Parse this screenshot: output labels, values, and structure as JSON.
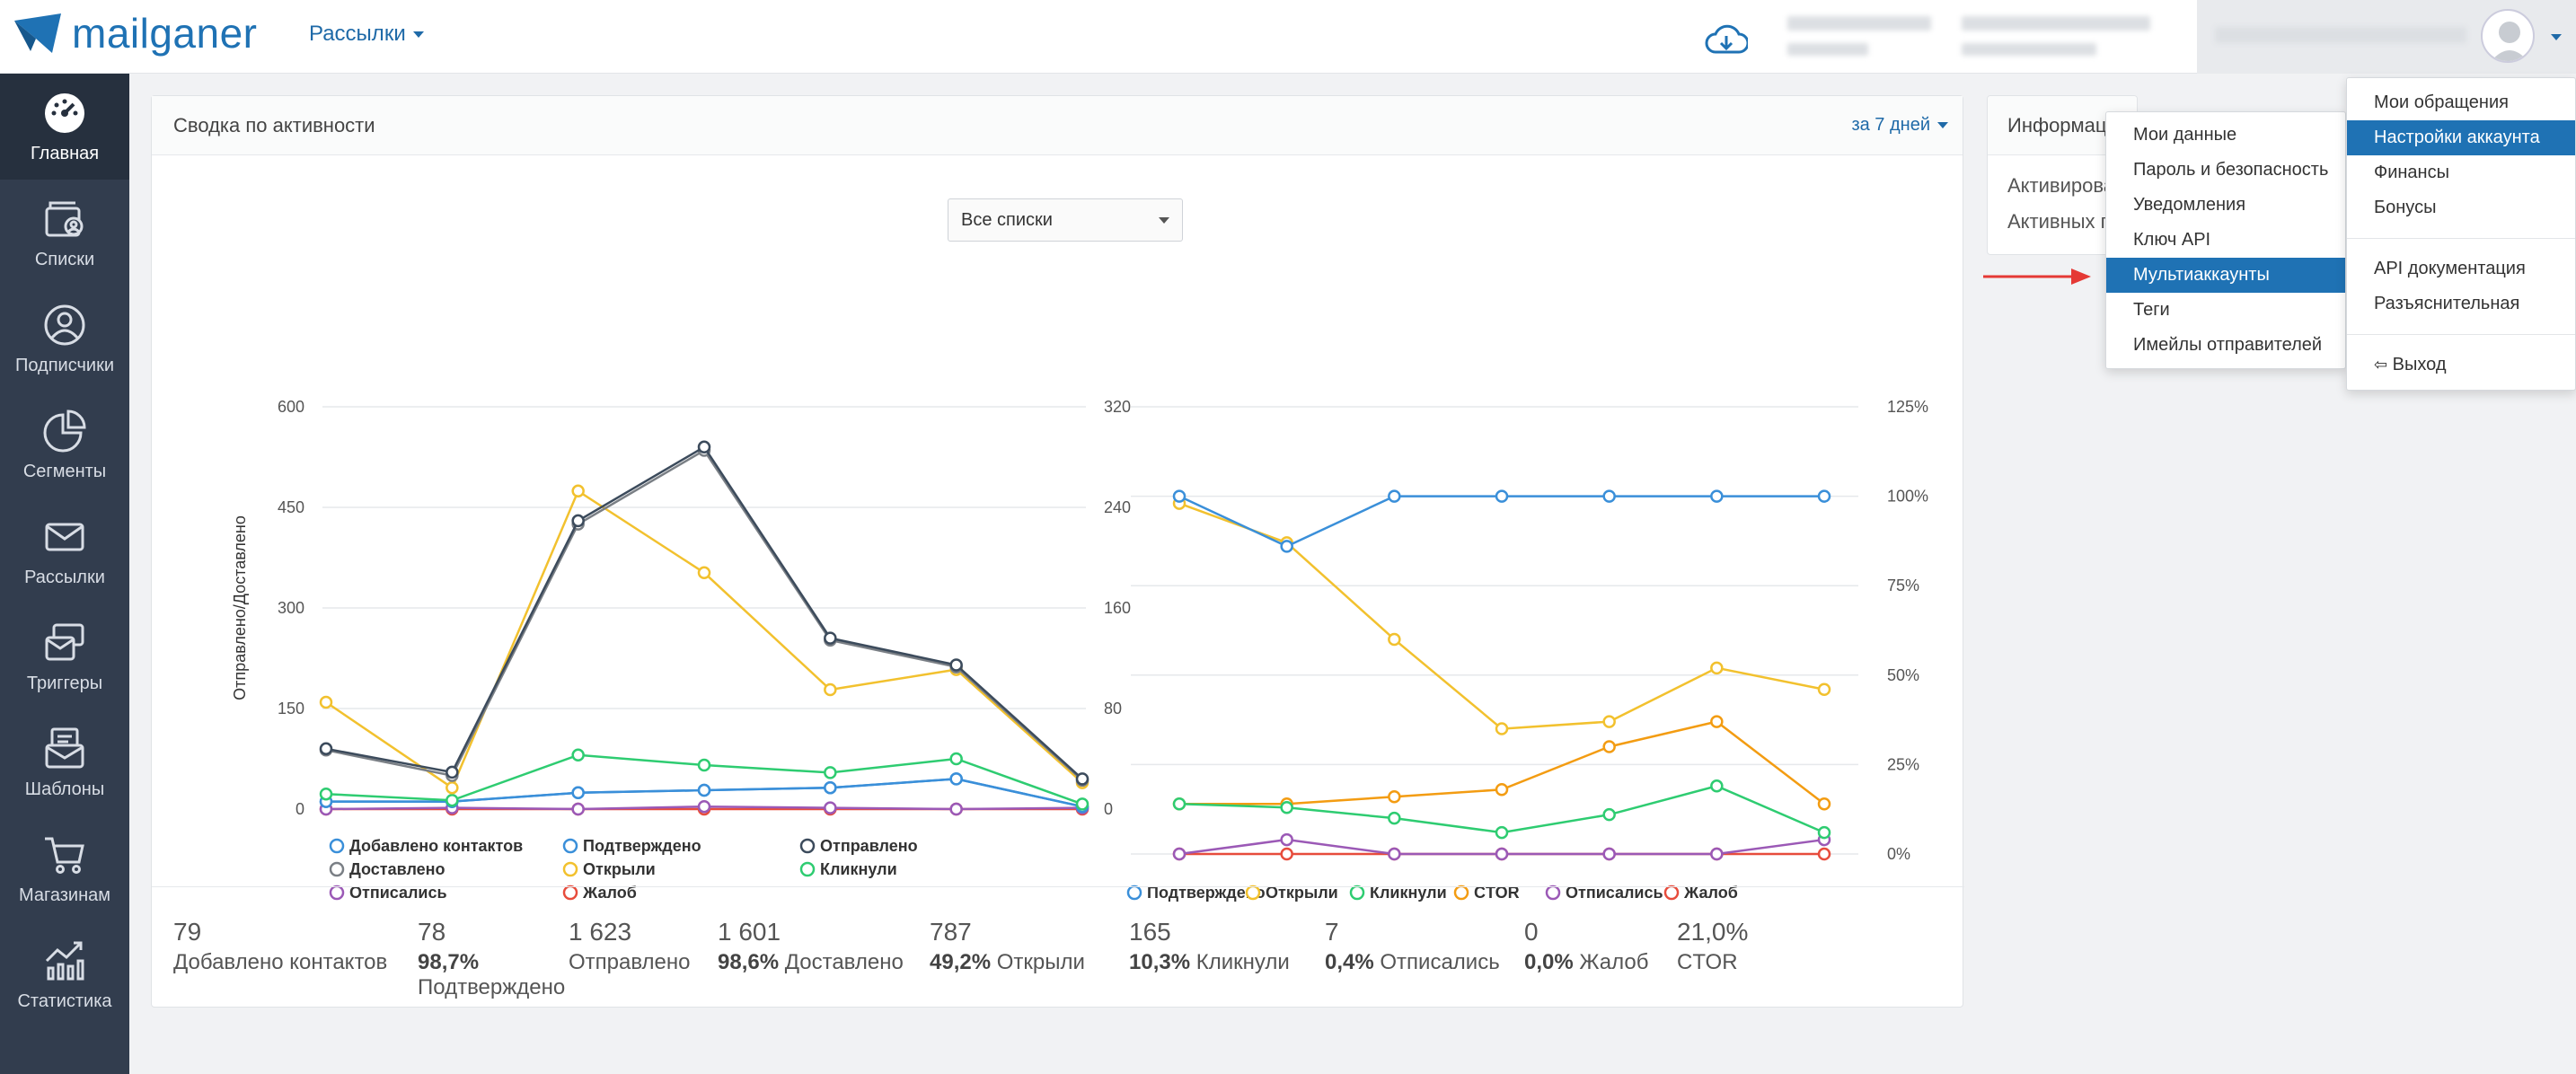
{
  "brand": {
    "name": "mailganer"
  },
  "topnav": {
    "mailings_label": "Рассылки"
  },
  "sidebar": {
    "items": [
      {
        "label": "Главная",
        "icon": "dashboard-icon"
      },
      {
        "label": "Списки",
        "icon": "lists-icon"
      },
      {
        "label": "Подписчики",
        "icon": "user-icon"
      },
      {
        "label": "Сегменты",
        "icon": "pie-icon"
      },
      {
        "label": "Рассылки",
        "icon": "envelope-icon"
      },
      {
        "label": "Триггеры",
        "icon": "trigger-icon"
      },
      {
        "label": "Шаблоны",
        "icon": "template-icon"
      },
      {
        "label": "Магазинам",
        "icon": "cart-icon"
      },
      {
        "label": "Статистика",
        "icon": "stats-icon"
      }
    ]
  },
  "activity": {
    "title": "Сводка по активности",
    "period": "за 7 дней",
    "list_select": "Все списки"
  },
  "info": {
    "title": "Информаци",
    "line1": "Активирова",
    "line2": "Активных п"
  },
  "stats": [
    {
      "num": "79",
      "pct": "",
      "label": "Добавлено контактов"
    },
    {
      "num": "78",
      "pct": "98,7%",
      "label": "Подтверждено"
    },
    {
      "num": "1 623",
      "pct": "",
      "label": "Отправлено"
    },
    {
      "num": "1 601",
      "pct": "98,6%",
      "label": "Доставлено"
    },
    {
      "num": "787",
      "pct": "49,2%",
      "label": "Открыли"
    },
    {
      "num": "165",
      "pct": "10,3%",
      "label": "Кликнули"
    },
    {
      "num": "7",
      "pct": "0,4%",
      "label": "Отписались"
    },
    {
      "num": "0",
      "pct": "0,0%",
      "label": "Жалоб"
    },
    {
      "num": "21,0%",
      "pct": "",
      "label": "CTOR"
    }
  ],
  "account_menu": {
    "items": [
      "Мои обращения",
      "Настройки аккаунта",
      "Финансы",
      "Бонусы",
      "API документация",
      "Разъяснительная",
      "Выход"
    ],
    "highlighted": "Настройки аккаунта"
  },
  "submenu": {
    "items": [
      "Мои данные",
      "Пароль и безопасность",
      "Уведомления",
      "Ключ API",
      "Мультиаккаунты",
      "Теги",
      "Имейлы отправителей"
    ],
    "highlighted": "Мультиаккаунты"
  },
  "colors": {
    "accent": "#1f72b4",
    "sidebar": "#323d4e",
    "blue": "#3a8fd9",
    "dark": "#3c4b5c",
    "gray": "#7a7f85",
    "yellow": "#f2c12e",
    "green": "#2ecc71",
    "orange": "#f39c12",
    "purple": "#9b59b6",
    "red": "#e74c3c"
  },
  "chart_data": [
    {
      "type": "line",
      "x_points": 7,
      "ylabel": "Отправлено/Доставлено",
      "ylim_left": [
        0,
        600
      ],
      "yticks_left": [
        "0",
        "150",
        "300",
        "450",
        "600"
      ],
      "ylim_right": [
        0,
        320
      ],
      "yticks_right": [
        "0",
        "80",
        "160",
        "240",
        "320"
      ],
      "legend": [
        "Добавлено контактов",
        "Подтверждено",
        "Отправлено",
        "Доставлено",
        "Открыли",
        "Кликнули",
        "Отписались",
        "Жалоб"
      ],
      "series": [
        {
          "name": "Отправлено",
          "axis": "left",
          "color": "#3c4b5c",
          "values": [
            90,
            55,
            430,
            540,
            255,
            215,
            45
          ]
        },
        {
          "name": "Доставлено",
          "axis": "left",
          "color": "#7a7f85",
          "values": [
            88,
            50,
            425,
            535,
            252,
            212,
            43
          ]
        },
        {
          "name": "Открыли",
          "axis": "right",
          "color": "#f2c12e",
          "values": [
            85,
            17,
            253,
            188,
            95,
            111,
            21
          ]
        },
        {
          "name": "Кликнули",
          "axis": "right",
          "color": "#2ecc71",
          "values": [
            12,
            7,
            43,
            35,
            29,
            40,
            4
          ]
        },
        {
          "name": "Добавлено контактов",
          "axis": "right",
          "color": "#3a8fd9",
          "values": [
            6,
            6,
            13,
            15,
            17,
            24,
            2
          ]
        },
        {
          "name": "Подтверждено",
          "axis": "right",
          "color": "#3a8fd9",
          "values": [
            6,
            6,
            13,
            15,
            17,
            24,
            2
          ]
        },
        {
          "name": "Отписались",
          "axis": "right",
          "color": "#9b59b6",
          "values": [
            0,
            1,
            0,
            2,
            1,
            0,
            1
          ]
        },
        {
          "name": "Жалоб",
          "axis": "right",
          "color": "#e74c3c",
          "values": [
            0,
            0,
            0,
            0,
            0,
            0,
            0
          ]
        }
      ]
    },
    {
      "type": "line",
      "x_points": 7,
      "ylim": [
        0,
        125
      ],
      "yticks": [
        "0%",
        "25%",
        "50%",
        "75%",
        "100%",
        "125%"
      ],
      "legend": [
        "Подтверждено",
        "Открыли",
        "Кликнули",
        "CTOR",
        "Отписались",
        "Жалоб"
      ],
      "series": [
        {
          "name": "Подтверждено",
          "color": "#3a8fd9",
          "values": [
            100,
            86,
            100,
            100,
            100,
            100,
            100
          ]
        },
        {
          "name": "Открыли",
          "color": "#f2c12e",
          "values": [
            98,
            87,
            60,
            35,
            37,
            52,
            46
          ]
        },
        {
          "name": "Кликнули",
          "color": "#2ecc71",
          "values": [
            14,
            13,
            10,
            6,
            11,
            19,
            6
          ]
        },
        {
          "name": "CTOR",
          "color": "#f39c12",
          "values": [
            14,
            14,
            16,
            18,
            30,
            37,
            14
          ]
        },
        {
          "name": "Отписались",
          "color": "#9b59b6",
          "values": [
            0,
            4,
            0,
            0,
            0,
            0,
            4
          ]
        },
        {
          "name": "Жалоб",
          "color": "#e74c3c",
          "values": [
            0,
            0,
            0,
            0,
            0,
            0,
            0
          ]
        }
      ]
    }
  ]
}
